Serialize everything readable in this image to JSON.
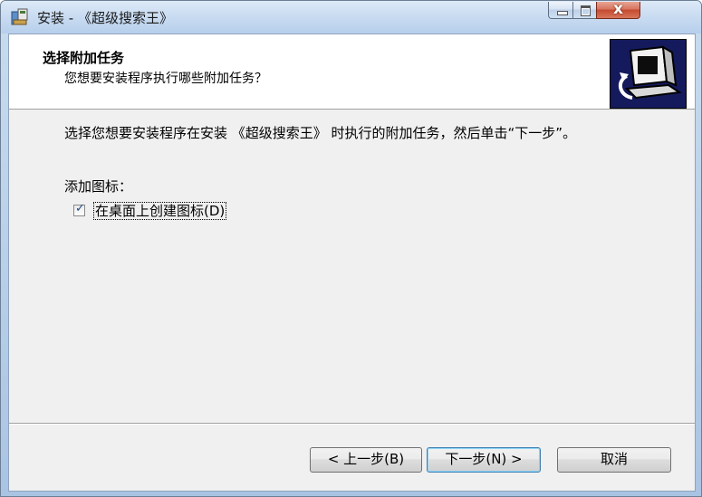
{
  "window": {
    "title": "安装 - 《超级搜索王》",
    "controls": {
      "close_label": "x"
    }
  },
  "header": {
    "title": "选择附加任务",
    "subtitle": "您想要安装程序执行哪些附加任务？"
  },
  "body": {
    "description": "选择您想要安装程序在安装 《超级搜索王》 时执行的附加任务，然后单击“下一步”。",
    "group_label": "添加图标：",
    "checkbox": {
      "label": "在桌面上创建图标(D)",
      "checked": true,
      "mark": "✓"
    }
  },
  "buttons": {
    "back": "< 上一步(B)",
    "next": "下一步(N) >",
    "cancel": "取消"
  },
  "colors": {
    "title_bar": "#c8dbf1",
    "close_button": "#c44a2f",
    "dialog_bg": "#f0f0f0",
    "default_button_border": "#3c7fb1"
  }
}
